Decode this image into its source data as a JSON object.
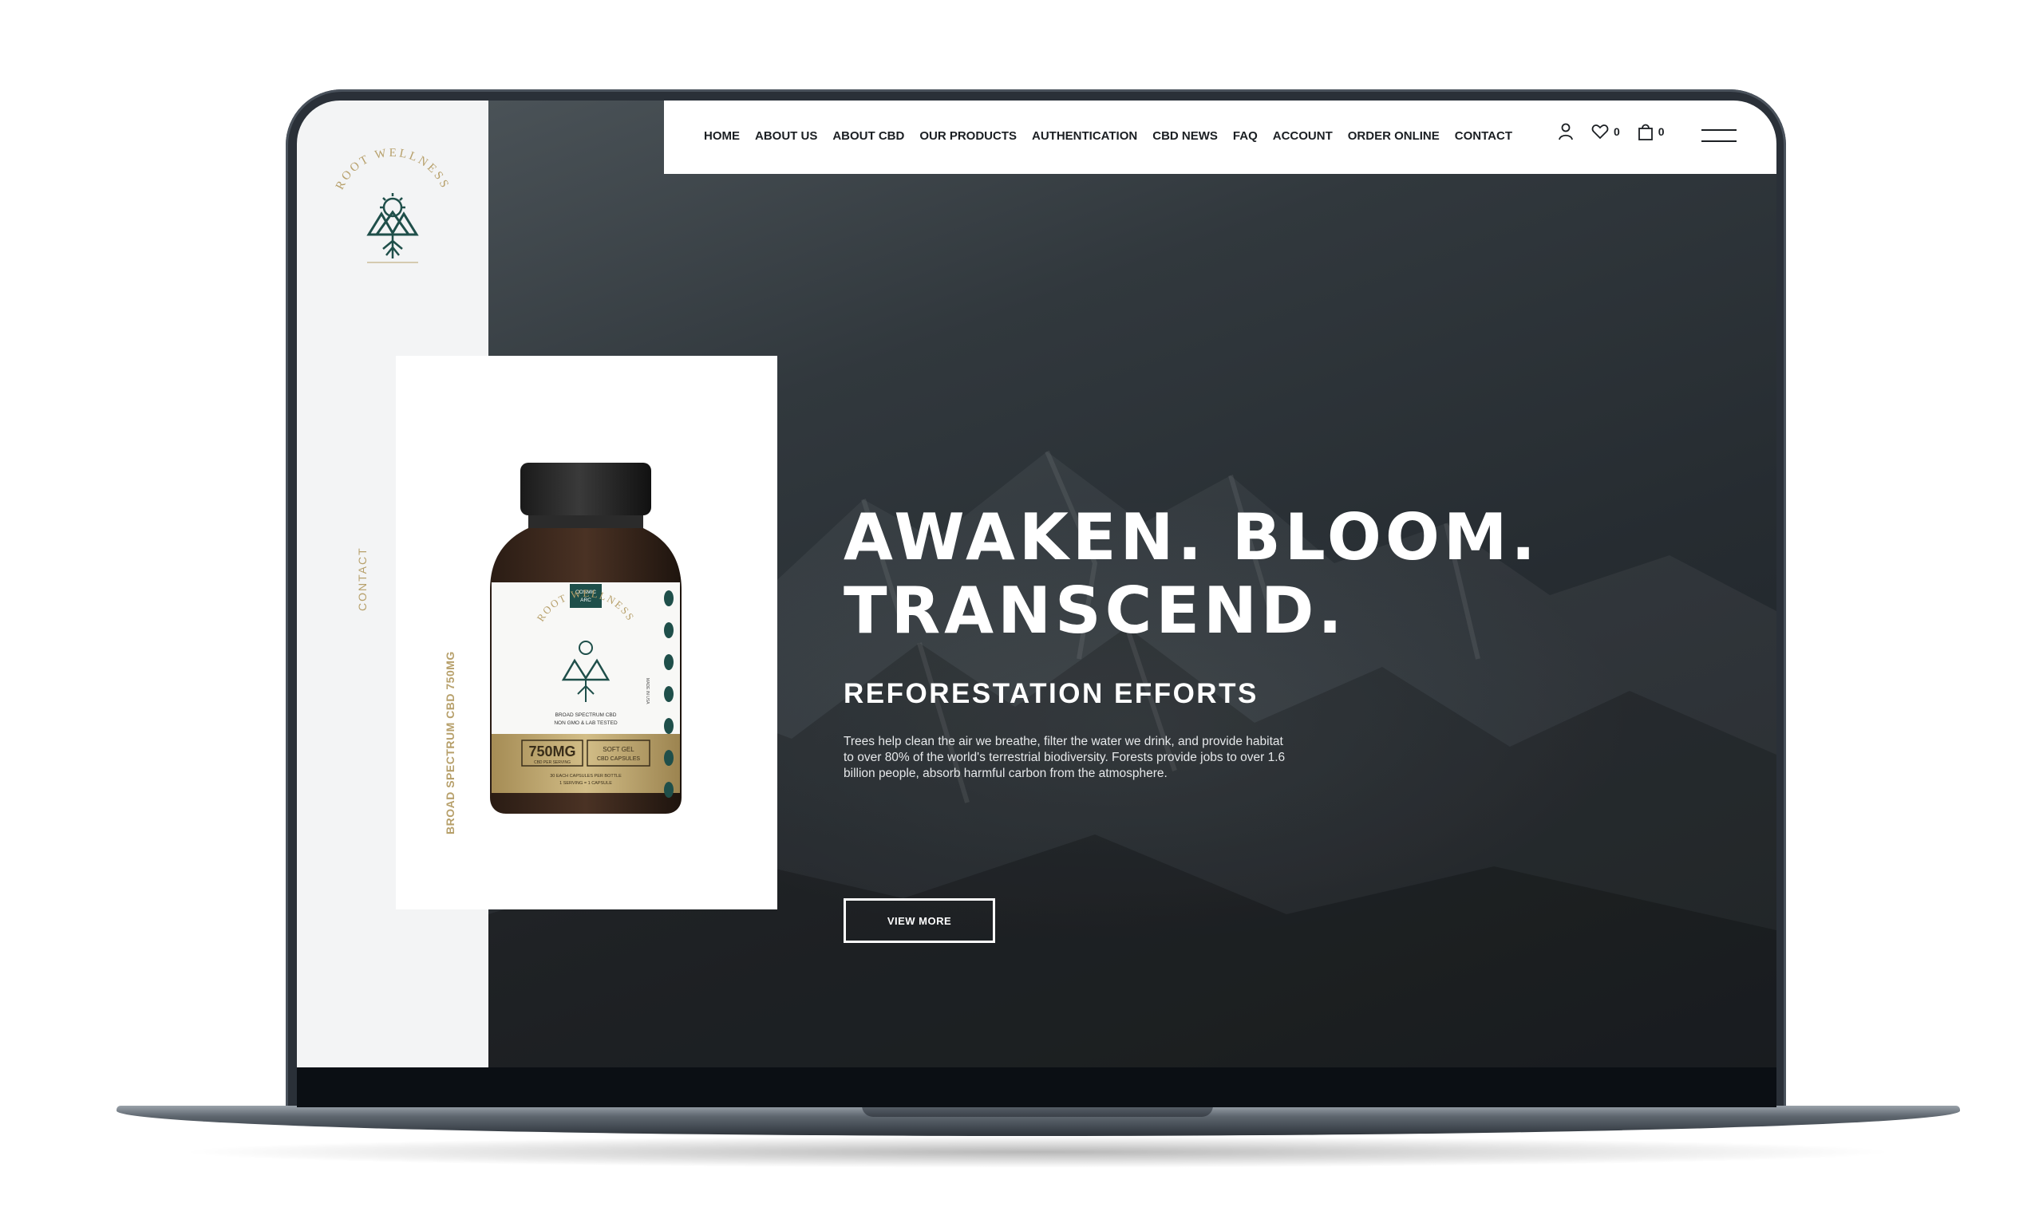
{
  "brand": {
    "name": "ROOT WELLNESS",
    "tagline": "AWAKEN. BLOOM. TRANSCEND.",
    "gold": "#b7a06b",
    "teal": "#1f4f4a"
  },
  "sidebar": {
    "contact_label": "CONTACT"
  },
  "nav": {
    "items": [
      "HOME",
      "ABOUT US",
      "ABOUT CBD",
      "OUR PRODUCTS",
      "AUTHENTICATION",
      "CBD NEWS",
      "FAQ",
      "ACCOUNT",
      "ORDER ONLINE",
      "CONTACT"
    ],
    "wishlist_count": "0",
    "cart_count": "0",
    "icons": [
      "user-icon",
      "heart-icon",
      "bag-icon",
      "hamburger-menu-icon"
    ]
  },
  "product": {
    "vertical_label": "BROAD SPECTRUM CBD 750MG",
    "bottle": {
      "brand": "ROOT WELLNESS",
      "badge_line1": "COSMIC",
      "badge_line2": "ARC",
      "desc_line1": "BROAD SPECTRUM CBD",
      "desc_line2": "NON GMO & LAB TESTED",
      "strength": "750MG",
      "strength_sub": "CBD PER SERVING",
      "type_line1": "SOFT GEL",
      "type_line2": "CBD CAPSULES",
      "count_line": "30 EACH CAPSULES PER BOTTLE",
      "serving_line": "1 SERVING = 1 CAPSULE",
      "side_text": "MADE IN USA"
    }
  },
  "hero": {
    "headline_line1": "AWAKEN. BLOOM.",
    "headline_line2": "TRANSCEND.",
    "subheadline": "REFORESTATION EFFORTS",
    "body": "Trees help clean the air we breathe, filter the water we drink, and provide habitat to over 80% of the world's terrestrial biodiversity. Forests provide jobs to over 1.6 billion people, absorb harmful carbon from the  atmosphere.",
    "cta_label": "VIEW MORE"
  }
}
